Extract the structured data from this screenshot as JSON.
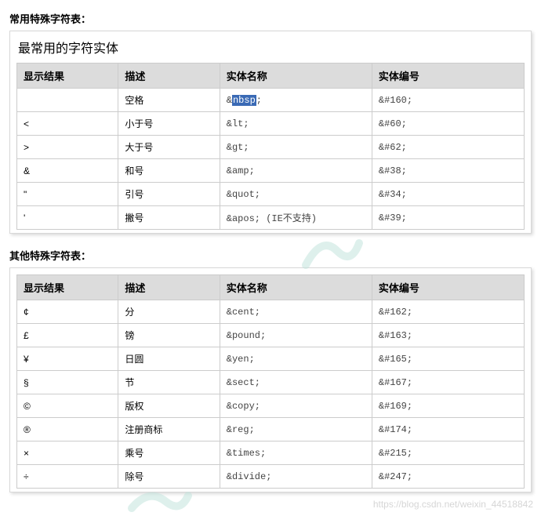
{
  "section1": {
    "heading": "常用特殊字符表：",
    "card_title": "最常用的字符实体",
    "headers": [
      "显示结果",
      "描述",
      "实体名称",
      "实体编号"
    ],
    "rows": [
      {
        "display": "",
        "desc": "空格",
        "name_pre": "&",
        "name_hl": "nbsp",
        "name_post": ";",
        "number": "&#160;"
      },
      {
        "display": "<",
        "desc": "小于号",
        "name": "&lt;",
        "number": "&#60;"
      },
      {
        "display": ">",
        "desc": "大于号",
        "name": "&gt;",
        "number": "&#62;"
      },
      {
        "display": "&",
        "desc": "和号",
        "name": "&amp;",
        "number": "&#38;"
      },
      {
        "display": "\"",
        "desc": "引号",
        "name": "&quot;",
        "number": "&#34;"
      },
      {
        "display": "'",
        "desc": "撇号",
        "name": "&apos; (IE不支持)",
        "number": "&#39;"
      }
    ]
  },
  "section2": {
    "heading": "其他特殊字符表：",
    "headers": [
      "显示结果",
      "描述",
      "实体名称",
      "实体编号"
    ],
    "rows": [
      {
        "display": "¢",
        "desc": "分",
        "name": "&cent;",
        "number": "&#162;"
      },
      {
        "display": "£",
        "desc": "镑",
        "name": "&pound;",
        "number": "&#163;"
      },
      {
        "display": "¥",
        "desc": "日圆",
        "name": "&yen;",
        "number": "&#165;"
      },
      {
        "display": "§",
        "desc": "节",
        "name": "&sect;",
        "number": "&#167;"
      },
      {
        "display": "©",
        "desc": "版权",
        "name": "&copy;",
        "number": "&#169;"
      },
      {
        "display": "®",
        "desc": "注册商标",
        "name": "&reg;",
        "number": "&#174;"
      },
      {
        "display": "×",
        "desc": "乘号",
        "name": "&times;",
        "number": "&#215;"
      },
      {
        "display": "÷",
        "desc": "除号",
        "name": "&divide;",
        "number": "&#247;"
      }
    ]
  },
  "watermark": "https://blog.csdn.net/weixin_44518842"
}
